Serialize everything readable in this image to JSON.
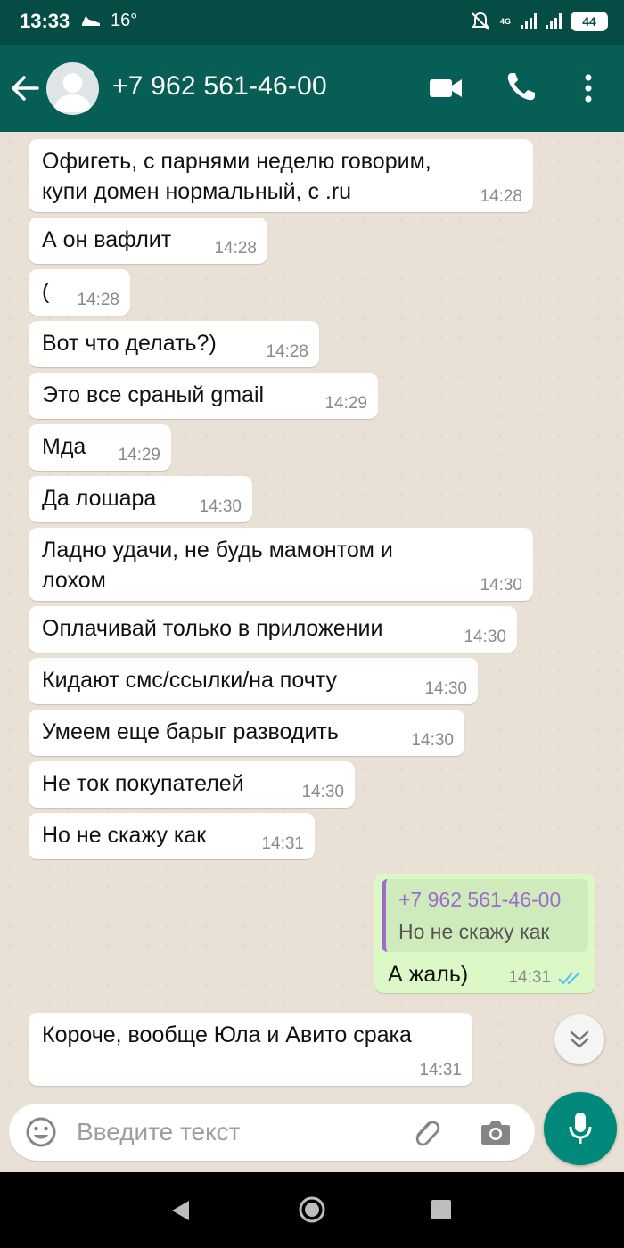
{
  "status_bar": {
    "time": "13:33",
    "temperature": "16°",
    "battery": "44",
    "network": "4G"
  },
  "header": {
    "contact_name": "+7 962 561-46-00"
  },
  "messages": [
    {
      "line1": "Офигеть, с парнями неделю говорим,",
      "line2": "купи домен нормальный, с .ru",
      "time": "14:28"
    },
    {
      "text": "А он вафлит",
      "time": "14:28"
    },
    {
      "text": "(",
      "time": "14:28"
    },
    {
      "text": "Вот что делать?)",
      "time": "14:28"
    },
    {
      "text": "Это все сраный gmail",
      "time": "14:29"
    },
    {
      "text": "Мда",
      "time": "14:29"
    },
    {
      "text": "Да лошара",
      "time": "14:30"
    },
    {
      "line1": "Ладно удачи, не будь мамонтом и",
      "line2": "лохом",
      "time": "14:30"
    },
    {
      "text": "Оплачивай только в приложении",
      "time": "14:30"
    },
    {
      "text": "Кидают смс/ссылки/на почту",
      "time": "14:30"
    },
    {
      "text": "Умеем еще барыг разводить",
      "time": "14:30"
    },
    {
      "text": "Не ток покупателей",
      "time": "14:30"
    },
    {
      "text": "Но не скажу как",
      "time": "14:31"
    }
  ],
  "outgoing": {
    "quote_author": "+7 962 561-46-00",
    "quote_text": "Но не скажу как",
    "text": "А жаль)",
    "time": "14:31",
    "status": "read"
  },
  "last_message": {
    "text": "Короче, вообще Юла и Авито срака",
    "time": "14:31"
  },
  "input": {
    "placeholder": "Введите текст"
  },
  "colors": {
    "header": "#075e54",
    "status_bar": "#054d44",
    "outgoing_bubble": "#dcf8c6",
    "accent": "#00897b",
    "quote_accent": "#9b6bcd",
    "read_ticks": "#4fc3f7"
  }
}
